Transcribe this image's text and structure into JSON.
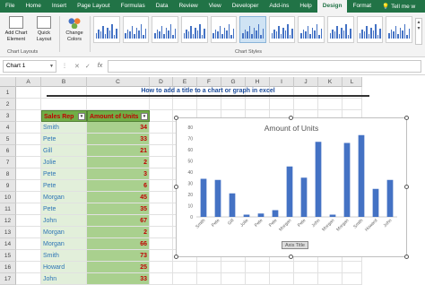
{
  "ribbon": {
    "tabs": [
      "File",
      "Home",
      "Insert",
      "Page Layout",
      "Formulas",
      "Data",
      "Review",
      "View",
      "Developer",
      "Add-ins",
      "Help",
      "Design",
      "Format"
    ],
    "active_tab": "Design",
    "tell_me": "Tell me w",
    "add_chart_element": "Add Chart Element",
    "quick_layout": "Quick Layout",
    "change_colors": "Change Colors",
    "group_chart_layouts": "Chart Layouts",
    "group_chart_styles": "Chart Styles"
  },
  "formula_bar": {
    "name_box": "Chart 1",
    "fx": "fx",
    "value": ""
  },
  "columns": [
    "A",
    "B",
    "C",
    "D",
    "E",
    "F",
    "G",
    "H",
    "I",
    "J",
    "K",
    "L"
  ],
  "rows": [
    "1",
    "2",
    "3",
    "4",
    "5",
    "6",
    "7",
    "8",
    "9",
    "10",
    "11",
    "12",
    "13",
    "14",
    "15",
    "16",
    "17"
  ],
  "sheet": {
    "banner": "How to add a title to a chart or graph in excel",
    "header_rep": "Sales Rep",
    "header_units": "Amount of Units",
    "data": [
      {
        "rep": "Smith",
        "units": "34"
      },
      {
        "rep": "Pete",
        "units": "33"
      },
      {
        "rep": "Gill",
        "units": "21"
      },
      {
        "rep": "Jolie",
        "units": "2"
      },
      {
        "rep": "Pete",
        "units": "3"
      },
      {
        "rep": "Pete",
        "units": "6"
      },
      {
        "rep": "Morgan",
        "units": "45"
      },
      {
        "rep": "Pete",
        "units": "35"
      },
      {
        "rep": "John",
        "units": "67"
      },
      {
        "rep": "Morgan",
        "units": "2"
      },
      {
        "rep": "Morgan",
        "units": "66"
      },
      {
        "rep": "Smith",
        "units": "73"
      },
      {
        "rep": "Howard",
        "units": "25"
      },
      {
        "rep": "John",
        "units": "33"
      }
    ]
  },
  "chart_data": {
    "type": "bar",
    "title": "Amount of Units",
    "xlabel": "Axis Title",
    "ylabel": "",
    "categories": [
      "Smith",
      "Pete",
      "Gill",
      "Jolie",
      "Pete",
      "Pete",
      "Morgan",
      "Pete",
      "John",
      "Morgan",
      "Morgan",
      "Smith",
      "Howard",
      "John"
    ],
    "values": [
      34,
      33,
      21,
      2,
      3,
      6,
      45,
      35,
      67,
      2,
      66,
      73,
      25,
      33
    ],
    "ylim": [
      0,
      80
    ],
    "yticks": [
      0,
      10,
      20,
      30,
      40,
      50,
      60,
      70,
      80
    ],
    "grid": false,
    "legend": "none",
    "bar_color": "#4472c4"
  }
}
